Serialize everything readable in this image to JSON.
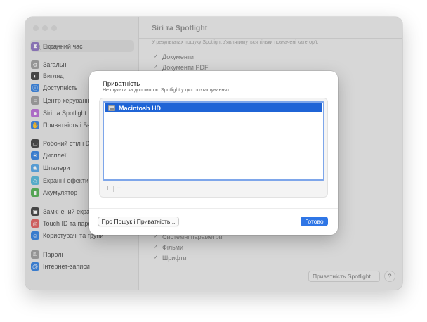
{
  "window": {
    "title": "Siri та Spotlight"
  },
  "sidebar": {
    "search_placeholder": "Пошук",
    "items": [
      {
        "label": "Екранний час",
        "icon": "hourglass-icon",
        "color": "#8a6fbf"
      },
      {
        "label": "Загальні",
        "icon": "gear-icon",
        "color": "#9a9a9a"
      },
      {
        "label": "Вигляд",
        "icon": "appearance-icon",
        "color": "#3a3a3a"
      },
      {
        "label": "Доступність",
        "icon": "accessibility-icon",
        "color": "#2d7de0"
      },
      {
        "label": "Центр керування",
        "icon": "control-center-icon",
        "color": "#9a9a9a"
      },
      {
        "label": "Siri та Spotlight",
        "icon": "siri-icon",
        "color": "#b86ad6"
      },
      {
        "label": "Приватність і Безпека",
        "icon": "privacy-hand-icon",
        "color": "#2d7de0"
      },
      {
        "label": "Робочий стіл і Dock",
        "icon": "desktop-dock-icon",
        "color": "#3a3a3a"
      },
      {
        "label": "Дисплеї",
        "icon": "display-icon",
        "color": "#2d7de0"
      },
      {
        "label": "Шпалери",
        "icon": "wallpaper-icon",
        "color": "#4fa3e6"
      },
      {
        "label": "Екранні ефекти",
        "icon": "screensaver-icon",
        "color": "#4fb6d9"
      },
      {
        "label": "Акумулятор",
        "icon": "battery-icon",
        "color": "#4cae4c"
      },
      {
        "label": "Замкнений екран",
        "icon": "lock-screen-icon",
        "color": "#3a3a3a"
      },
      {
        "label": "Touch ID та пароль",
        "icon": "fingerprint-icon",
        "color": "#e05a5a"
      },
      {
        "label": "Користувачі та групи",
        "icon": "users-icon",
        "color": "#2d7de0"
      },
      {
        "label": "Паролі",
        "icon": "key-icon",
        "color": "#9a9a9a"
      },
      {
        "label": "Інтернет-записи",
        "icon": "at-icon",
        "color": "#2d7de0"
      }
    ]
  },
  "main": {
    "note": "У результатах пошуку Spotlight з'являтимуться тільки позначені категорії.",
    "categories": [
      {
        "label": "Документи",
        "checked": true
      },
      {
        "label": "Документи PDF",
        "checked": true
      },
      {
        "label": "Системні параметри",
        "checked": true
      },
      {
        "label": "Фільми",
        "checked": true
      },
      {
        "label": "Шрифти",
        "checked": true
      }
    ],
    "spotlight_privacy_button": "Приватність Spotlight...",
    "help_button": "?"
  },
  "sheet": {
    "title": "Приватність",
    "subtitle": "Не шукати за допомогою Spotlight у цих розташуваннях.",
    "list_items": [
      {
        "label": "Macintosh HD",
        "icon": "hard-drive-icon",
        "selected": true
      }
    ],
    "add_label": "+",
    "remove_label": "−",
    "about_button": "Про Пошук і Приватність...",
    "done_button": "Готово"
  },
  "colors": {
    "accent": "#2f76e6",
    "selection": "#1f64d6",
    "focus_ring": "#7ea6ea"
  }
}
